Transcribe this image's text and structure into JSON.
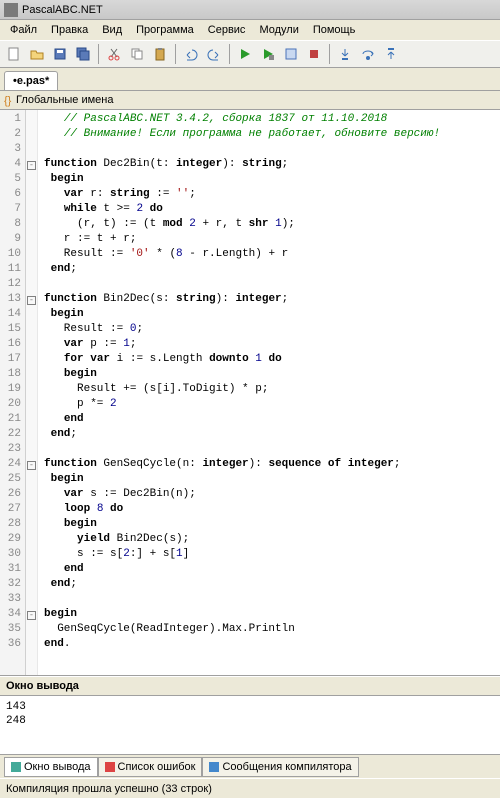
{
  "title": "PascalABC.NET",
  "menu": [
    "Файл",
    "Правка",
    "Вид",
    "Программа",
    "Сервис",
    "Модули",
    "Помощь"
  ],
  "tab": "•e.pas*",
  "namespace": "Глобальные имена",
  "code_lines": [
    {
      "n": 1,
      "f": "",
      "t": "   <span class='cm'>// PascalABC.NET 3.4.2, сборка 1837 от 11.10.2018</span>"
    },
    {
      "n": 2,
      "f": "",
      "t": "   <span class='cm'>// Внимание! Если программа не работает, обновите версию!</span>"
    },
    {
      "n": 3,
      "f": "",
      "t": ""
    },
    {
      "n": 4,
      "f": "-",
      "t": "<span class='kw'>function</span> Dec2Bin(t: <span class='kw'>integer</span>): <span class='kw'>string</span>;"
    },
    {
      "n": 5,
      "f": "",
      "t": " <span class='kw'>begin</span>"
    },
    {
      "n": 6,
      "f": "",
      "t": "   <span class='kw'>var</span> r: <span class='kw'>string</span> := <span class='str'>''</span>;"
    },
    {
      "n": 7,
      "f": "",
      "t": "   <span class='kw'>while</span> t &gt;= <span class='num'>2</span> <span class='kw'>do</span>"
    },
    {
      "n": 8,
      "f": "",
      "t": "     (r, t) := (t <span class='kw'>mod</span> <span class='num'>2</span> + r, t <span class='kw'>shr</span> <span class='num'>1</span>);"
    },
    {
      "n": 9,
      "f": "",
      "t": "   r := t + r;"
    },
    {
      "n": 10,
      "f": "",
      "t": "   Result := <span class='str'>'0'</span> * (<span class='num'>8</span> - r.Length) + r"
    },
    {
      "n": 11,
      "f": "",
      "t": " <span class='kw'>end</span>;"
    },
    {
      "n": 12,
      "f": "",
      "t": ""
    },
    {
      "n": 13,
      "f": "-",
      "t": "<span class='kw'>function</span> Bin2Dec(s: <span class='kw'>string</span>): <span class='kw'>integer</span>;"
    },
    {
      "n": 14,
      "f": "",
      "t": " <span class='kw'>begin</span>"
    },
    {
      "n": 15,
      "f": "",
      "t": "   Result := <span class='num'>0</span>;"
    },
    {
      "n": 16,
      "f": "",
      "t": "   <span class='kw'>var</span> p := <span class='num'>1</span>;"
    },
    {
      "n": 17,
      "f": "",
      "t": "   <span class='kw'>for</span> <span class='kw'>var</span> i := s.Length <span class='kw'>downto</span> <span class='num'>1</span> <span class='kw'>do</span>"
    },
    {
      "n": 18,
      "f": "",
      "t": "   <span class='kw'>begin</span>"
    },
    {
      "n": 19,
      "f": "",
      "t": "     Result += (s[i].ToDigit) * p;"
    },
    {
      "n": 20,
      "f": "",
      "t": "     p *= <span class='num'>2</span>"
    },
    {
      "n": 21,
      "f": "",
      "t": "   <span class='kw'>end</span>"
    },
    {
      "n": 22,
      "f": "",
      "t": " <span class='kw'>end</span>;"
    },
    {
      "n": 23,
      "f": "",
      "t": ""
    },
    {
      "n": 24,
      "f": "-",
      "t": "<span class='kw'>function</span> GenSeqCycle(n: <span class='kw'>integer</span>): <span class='kw'>sequence of</span> <span class='kw'>integer</span>;"
    },
    {
      "n": 25,
      "f": "",
      "t": " <span class='kw'>begin</span>"
    },
    {
      "n": 26,
      "f": "",
      "t": "   <span class='kw'>var</span> s := Dec2Bin(n);"
    },
    {
      "n": 27,
      "f": "",
      "t": "   <span class='kw'>loop</span> <span class='num'>8</span> <span class='kw'>do</span>"
    },
    {
      "n": 28,
      "f": "",
      "t": "   <span class='kw'>begin</span>"
    },
    {
      "n": 29,
      "f": "",
      "t": "     <span class='kw'>yield</span> Bin2Dec(s);"
    },
    {
      "n": 30,
      "f": "",
      "t": "     s := s[<span class='num'>2</span>:] + s[<span class='num'>1</span>]"
    },
    {
      "n": 31,
      "f": "",
      "t": "   <span class='kw'>end</span>"
    },
    {
      "n": 32,
      "f": "",
      "t": " <span class='kw'>end</span>;"
    },
    {
      "n": 33,
      "f": "",
      "t": ""
    },
    {
      "n": 34,
      "f": "-",
      "t": "<span class='kw'>begin</span>"
    },
    {
      "n": 35,
      "f": "",
      "t": "  GenSeqCycle(ReadInteger).Max.Println"
    },
    {
      "n": 36,
      "f": "",
      "t": "<span class='kw'>end</span>."
    }
  ],
  "output_header": "Окно вывода",
  "output_lines": [
    "143",
    "248"
  ],
  "bottom_tabs": [
    {
      "label": "Окно вывода",
      "icon": "#4a9",
      "active": true
    },
    {
      "label": "Список ошибок",
      "icon": "#d44",
      "active": false
    },
    {
      "label": "Сообщения компилятора",
      "icon": "#48c",
      "active": false
    }
  ],
  "status": "Компиляция прошла успешно (33 строк)"
}
